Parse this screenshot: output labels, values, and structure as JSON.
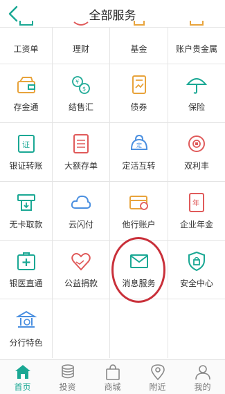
{
  "header": {
    "title": "全部服务"
  },
  "colors": {
    "accent": "#1aa894",
    "icon_orange": "#e8a33b",
    "icon_red": "#e05a5a",
    "icon_blue": "#4a8fe0",
    "highlight": "#c9303a"
  },
  "grid": {
    "row0": [
      "工资单",
      "理财",
      "基金",
      "账户贵金属"
    ],
    "row1": [
      "存金通",
      "结售汇",
      "债券",
      "保险"
    ],
    "row2": [
      "银证转账",
      "大额存单",
      "定活互转",
      "双利丰"
    ],
    "row3": [
      "无卡取款",
      "云闪付",
      "他行账户",
      "企业年金"
    ],
    "row4": [
      "银医直通",
      "公益捐款",
      "消息服务",
      "安全中心"
    ],
    "row5": [
      "分行特色"
    ]
  },
  "icons": {
    "row1": [
      "wallet-icon",
      "exchange-icon",
      "bond-icon",
      "umbrella-icon"
    ],
    "row2": [
      "certificate-icon",
      "deposit-icon",
      "coin-purse-icon",
      "coins-icon"
    ],
    "row3": [
      "atm-icon",
      "cloud-icon",
      "card-icon",
      "pension-icon"
    ],
    "row4": [
      "medical-icon",
      "heart-hands-icon",
      "envelope-icon",
      "shield-lock-icon"
    ],
    "row5": [
      "bank-building-icon"
    ]
  },
  "tabs": [
    "首页",
    "投资",
    "商城",
    "附近",
    "我的"
  ]
}
